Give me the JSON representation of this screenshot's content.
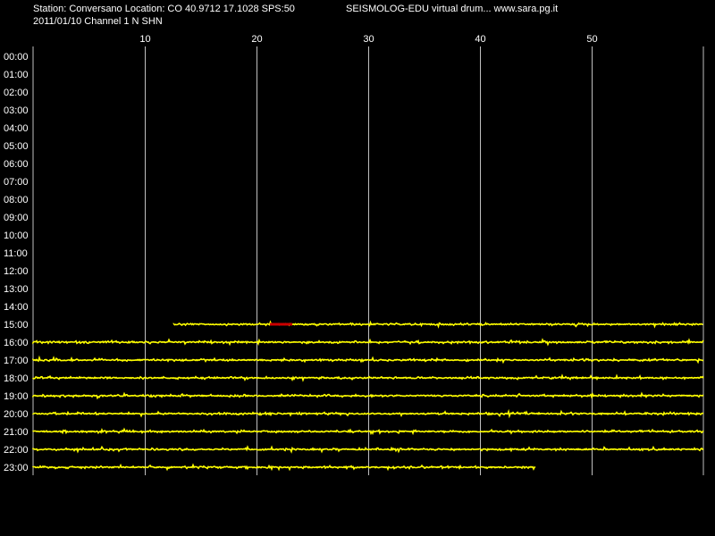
{
  "header": {
    "station_line": "Station: Conversano Location: CO 40.9712 17.1028 SPS:50",
    "program_line": "SEISMOLOG-EDU virtual drum... www.sara.pg.it",
    "date_line": "2011/01/10  Channel 1 N SHN"
  },
  "colors": {
    "background": "#000000",
    "trace": "#ffff00",
    "event": "#cc0000",
    "grid": "#c0c0c0",
    "text": "#ffffff"
  },
  "chart_data": {
    "type": "line",
    "x_unit": "minutes",
    "xlim": [
      0,
      60
    ],
    "x_ticks": [
      10,
      20,
      30,
      40,
      50
    ],
    "y_ticks": [
      "00:00",
      "01:00",
      "02:00",
      "03:00",
      "04:00",
      "05:00",
      "06:00",
      "07:00",
      "08:00",
      "09:00",
      "10:00",
      "11:00",
      "12:00",
      "13:00",
      "14:00",
      "15:00",
      "16:00",
      "17:00",
      "18:00",
      "19:00",
      "20:00",
      "21:00",
      "22:00",
      "23:00"
    ],
    "grid": "vertical",
    "series": [
      {
        "hour": "15:00",
        "start": 12.6,
        "end": 60
      },
      {
        "hour": "16:00",
        "start": 0,
        "end": 60
      },
      {
        "hour": "17:00",
        "start": 0,
        "end": 60
      },
      {
        "hour": "18:00",
        "start": 0,
        "end": 60
      },
      {
        "hour": "19:00",
        "start": 0,
        "end": 60
      },
      {
        "hour": "20:00",
        "start": 0,
        "end": 60
      },
      {
        "hour": "21:00",
        "start": 0,
        "end": 60
      },
      {
        "hour": "22:00",
        "start": 0,
        "end": 60
      },
      {
        "hour": "23:00",
        "start": 0,
        "end": 45
      }
    ],
    "events": [
      {
        "hour": "15:00",
        "start": 21.2,
        "end": 23.2
      }
    ]
  }
}
